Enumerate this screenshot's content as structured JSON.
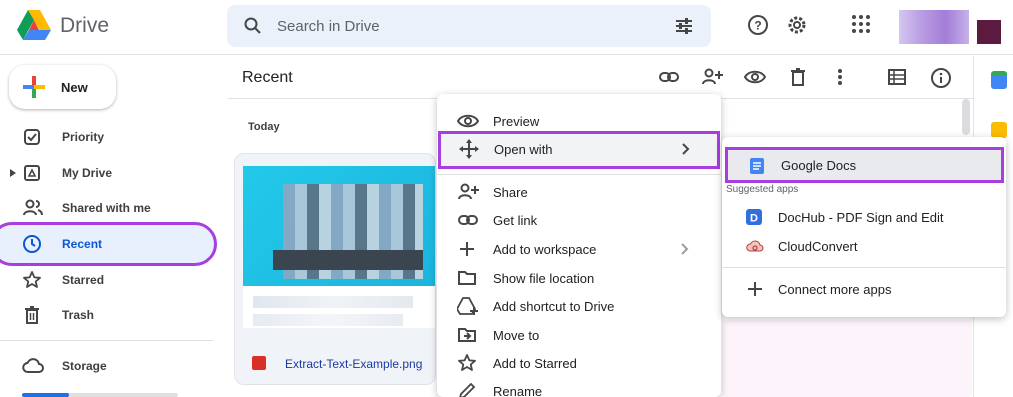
{
  "app": {
    "name": "Drive"
  },
  "search": {
    "placeholder": "Search in Drive"
  },
  "sidebar": {
    "new_label": "New",
    "items": [
      {
        "label": "Priority",
        "icon": "priority-icon"
      },
      {
        "label": "My Drive",
        "icon": "my-drive-icon"
      },
      {
        "label": "Shared with me",
        "icon": "shared-icon"
      },
      {
        "label": "Recent",
        "icon": "clock-icon",
        "selected": true
      },
      {
        "label": "Starred",
        "icon": "star-icon"
      },
      {
        "label": "Trash",
        "icon": "trash-icon"
      },
      {
        "label": "Storage",
        "icon": "cloud-icon"
      }
    ]
  },
  "main": {
    "title": "Recent",
    "section": "Today",
    "file": {
      "name": "Extract-Text-Example.png"
    }
  },
  "context_menu": {
    "items": [
      {
        "label": "Preview",
        "icon": "eye-icon"
      },
      {
        "label": "Open with",
        "icon": "move-icon",
        "submenu": true,
        "highlighted": true
      },
      {
        "label": "Share",
        "icon": "person-add-icon"
      },
      {
        "label": "Get link",
        "icon": "link-icon"
      },
      {
        "label": "Add to workspace",
        "icon": "plus-icon",
        "submenu": true
      },
      {
        "label": "Show file location",
        "icon": "folder-icon"
      },
      {
        "label": "Add shortcut to Drive",
        "icon": "shortcut-icon"
      },
      {
        "label": "Move to",
        "icon": "move-to-icon"
      },
      {
        "label": "Add to Starred",
        "icon": "star-icon"
      },
      {
        "label": "Rename",
        "icon": "pencil-icon"
      }
    ]
  },
  "open_with": {
    "primary": {
      "label": "Google Docs",
      "icon": "google-docs-icon"
    },
    "suggested_label": "Suggested apps",
    "apps": [
      {
        "label": "DocHub - PDF Sign and Edit",
        "icon": "dochub-icon"
      },
      {
        "label": "CloudConvert",
        "icon": "cloudconvert-icon"
      }
    ],
    "connect_label": "Connect more apps"
  },
  "colors": {
    "highlight": "#a63ee0",
    "accent": "#1a73e8"
  }
}
